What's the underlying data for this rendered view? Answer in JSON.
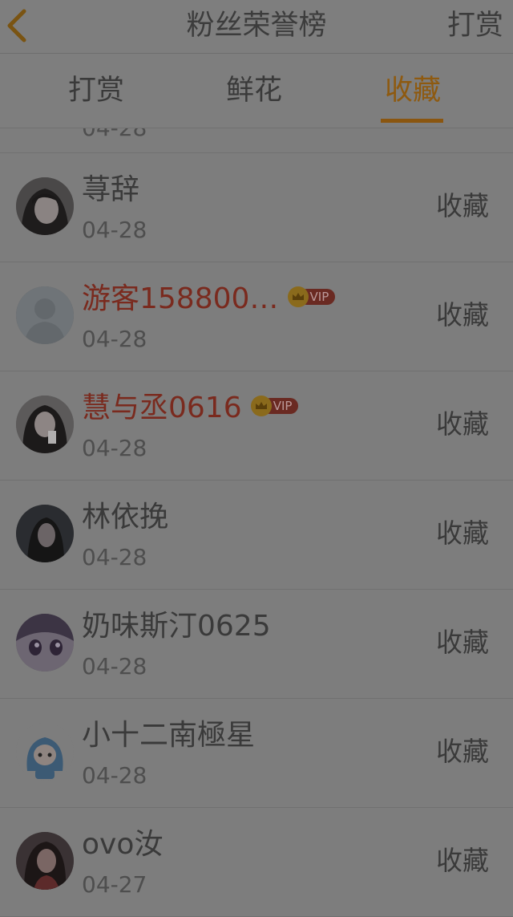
{
  "header": {
    "title": "粉丝荣誉榜",
    "right_label": "打赏"
  },
  "tabs": [
    {
      "label": "打赏",
      "active": false
    },
    {
      "label": "鲜花",
      "active": false
    },
    {
      "label": "收藏",
      "active": true
    }
  ],
  "colors": {
    "active_tab": "#8e5a10",
    "vip_name": "#7a2a1e",
    "background_dim": "#7d7d7d"
  },
  "list": {
    "partial_top_date": "04-28",
    "items": [
      {
        "name": "荨辞",
        "date": "04-28",
        "action": "收藏",
        "vip": false,
        "avatar": "girl-photo-avatar"
      },
      {
        "name": "游客158800…",
        "date": "04-28",
        "action": "收藏",
        "vip": true,
        "vip_label": "VIP",
        "avatar": "default-user-avatar"
      },
      {
        "name": "慧与丞0616",
        "date": "04-28",
        "action": "收藏",
        "vip": true,
        "vip_label": "VIP",
        "avatar": "girl-photo-avatar"
      },
      {
        "name": "林依挽",
        "date": "04-28",
        "action": "收藏",
        "vip": false,
        "avatar": "girl-photo-avatar"
      },
      {
        "name": "奶味斯汀0625",
        "date": "04-28",
        "action": "收藏",
        "vip": false,
        "avatar": "anime-avatar"
      },
      {
        "name": "小十二南極星",
        "date": "04-28",
        "action": "收藏",
        "vip": false,
        "avatar": "cartoon-avatar"
      },
      {
        "name": "ovo汝",
        "date": "04-27",
        "action": "收藏",
        "vip": false,
        "avatar": "girl-photo-avatar"
      }
    ]
  }
}
